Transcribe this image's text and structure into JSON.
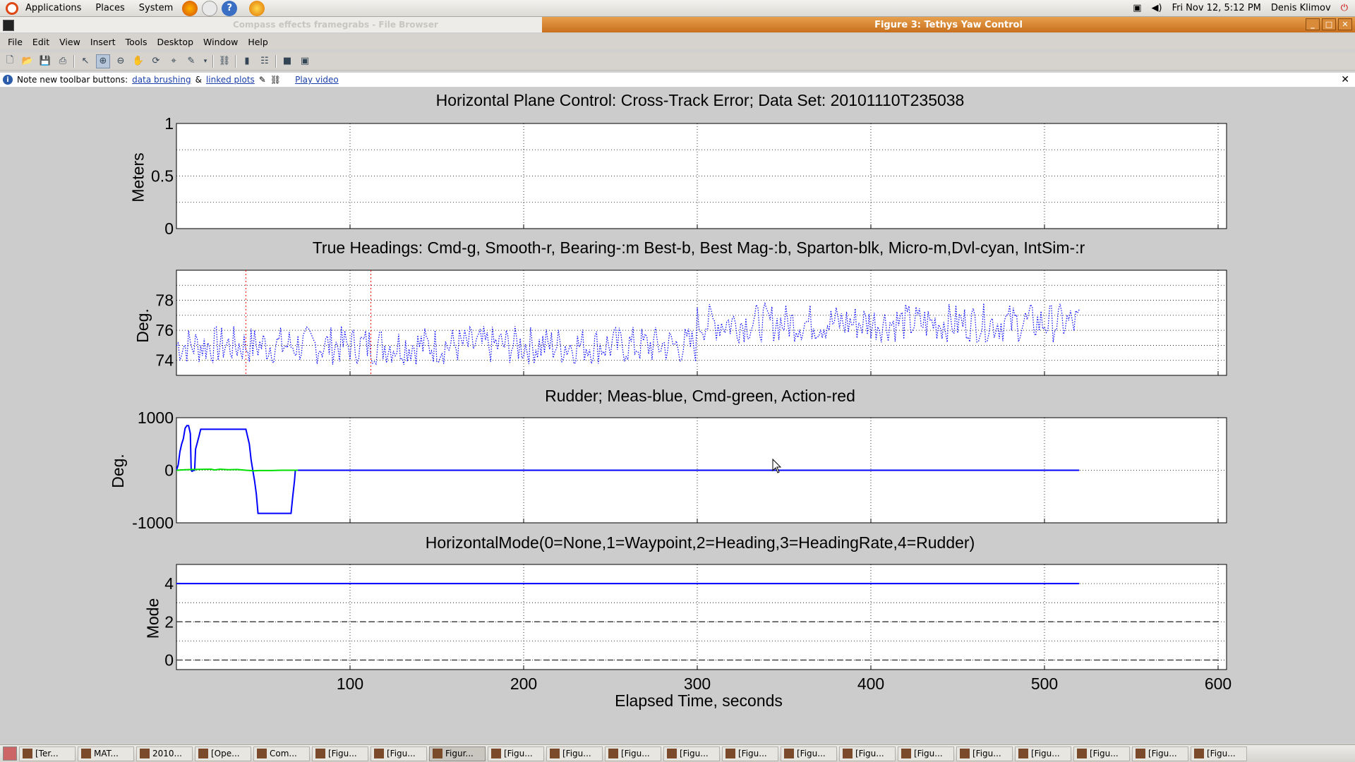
{
  "top_panel": {
    "menus": [
      "Applications",
      "Places",
      "System"
    ],
    "datetime": "Fri Nov 12,  5:12 PM",
    "user": "Denis Klimov"
  },
  "titlebar": {
    "inactive_title": "Compass effects framegrabs - File Browser",
    "active_title": "Figure 3: Tethys Yaw Control"
  },
  "menubar": [
    "File",
    "Edit",
    "View",
    "Insert",
    "Tools",
    "Desktop",
    "Window",
    "Help"
  ],
  "notebar": {
    "prefix": "Note new toolbar buttons:",
    "link1": "data brushing",
    "amp": "&",
    "link2": "linked plots",
    "link3": "Play video"
  },
  "chart_data": [
    {
      "type": "line",
      "title": "Horizontal Plane Control: Cross-Track Error; Data Set: 20101110T235038",
      "xlabel": "",
      "ylabel": "Meters",
      "xlim": [
        0,
        600
      ],
      "ylim": [
        0,
        1
      ],
      "yticks": [
        "0",
        "0.5",
        "1"
      ],
      "grid": true,
      "series": []
    },
    {
      "type": "line",
      "title": "True Headings: Cmd-g, Smooth-r, Bearing-:m Best-b, Best Mag-:b, Sparton-blk, Micro-m,Dvl-cyan, IntSim-:r",
      "xlabel": "",
      "ylabel": "Deg.",
      "xlim": [
        0,
        600
      ],
      "ylim": [
        73,
        80
      ],
      "yticks": [
        "74",
        "76",
        "78"
      ],
      "grid": true,
      "series": [
        {
          "style": "dotted",
          "color": "#0000ff",
          "x": [
            0,
            520
          ],
          "level_start": 75,
          "level_shift_at": 300,
          "level_end": 76.5,
          "noise": 1.0
        },
        {
          "style": "dotted",
          "color": "#ff0000",
          "vertical_at": [
            40,
            112
          ]
        }
      ]
    },
    {
      "type": "line",
      "title": "Rudder; Meas-blue, Cmd-green, Action-red",
      "xlabel": "",
      "ylabel": "Deg.",
      "xlim": [
        0,
        600
      ],
      "ylim": [
        -1000,
        1000
      ],
      "yticks": [
        "-1000",
        "0",
        "1000"
      ],
      "grid": true,
      "series": [
        {
          "color": "#0000ff",
          "x": [
            0,
            1,
            2,
            3,
            4,
            5,
            6,
            7,
            8,
            8.5,
            9,
            10,
            10.5,
            11,
            13,
            14,
            17,
            18,
            20,
            21,
            22,
            23,
            40,
            42,
            43,
            44,
            45,
            46,
            47,
            48,
            66,
            67,
            68,
            68.5,
            69,
            70,
            520
          ],
          "y": [
            0,
            100,
            350,
            500,
            600,
            800,
            850,
            850,
            700,
            0,
            -20,
            0,
            0,
            400,
            650,
            780,
            780,
            780,
            780,
            780,
            780,
            780,
            780,
            500,
            200,
            0,
            -200,
            -450,
            -820,
            -820,
            -820,
            -500,
            -200,
            0,
            0,
            0,
            0
          ]
        },
        {
          "color": "#00dd00",
          "x": [
            0,
            5,
            10,
            20,
            22,
            25,
            30,
            35,
            40,
            45,
            48,
            55,
            60,
            65,
            70
          ],
          "y": [
            0,
            10,
            15,
            20,
            5,
            20,
            10,
            15,
            0,
            -10,
            -5,
            -5,
            0,
            0,
            0
          ]
        }
      ]
    },
    {
      "type": "line",
      "title": "HorizontalMode(0=None,1=Waypoint,2=Heading,3=HeadingRate,4=Rudder)",
      "xlabel": "Elapsed Time,  seconds",
      "ylabel": "Mode",
      "xlim": [
        0,
        600
      ],
      "ylim": [
        -0.5,
        5
      ],
      "yticks": [
        "0",
        "2",
        "4"
      ],
      "xticks": [
        "100",
        "200",
        "300",
        "400",
        "500",
        "600"
      ],
      "grid": true,
      "series": [
        {
          "color": "#0000ff",
          "x": [
            0,
            520
          ],
          "y": [
            4,
            4
          ]
        },
        {
          "color": "#444444",
          "style": "dashed",
          "x": [
            0,
            600
          ],
          "y": [
            2,
            2
          ]
        },
        {
          "color": "#444444",
          "style": "dashed",
          "x": [
            0,
            600
          ],
          "y": [
            0,
            0
          ]
        }
      ]
    }
  ],
  "taskbar": [
    {
      "label": "[Ter...",
      "active": false
    },
    {
      "label": "MAT...",
      "active": false
    },
    {
      "label": "2010...",
      "active": false
    },
    {
      "label": "[Ope...",
      "active": false
    },
    {
      "label": "Com...",
      "active": false
    },
    {
      "label": "[Figu...",
      "active": false
    },
    {
      "label": "[Figu...",
      "active": false
    },
    {
      "label": "Figur...",
      "active": true
    },
    {
      "label": "[Figu...",
      "active": false
    },
    {
      "label": "[Figu...",
      "active": false
    },
    {
      "label": "[Figu...",
      "active": false
    },
    {
      "label": "[Figu...",
      "active": false
    },
    {
      "label": "[Figu...",
      "active": false
    },
    {
      "label": "[Figu...",
      "active": false
    },
    {
      "label": "[Figu...",
      "active": false
    },
    {
      "label": "[Figu...",
      "active": false
    },
    {
      "label": "[Figu...",
      "active": false
    },
    {
      "label": "[Figu...",
      "active": false
    },
    {
      "label": "[Figu...",
      "active": false
    },
    {
      "label": "[Figu...",
      "active": false
    },
    {
      "label": "[Figu...",
      "active": false
    }
  ]
}
